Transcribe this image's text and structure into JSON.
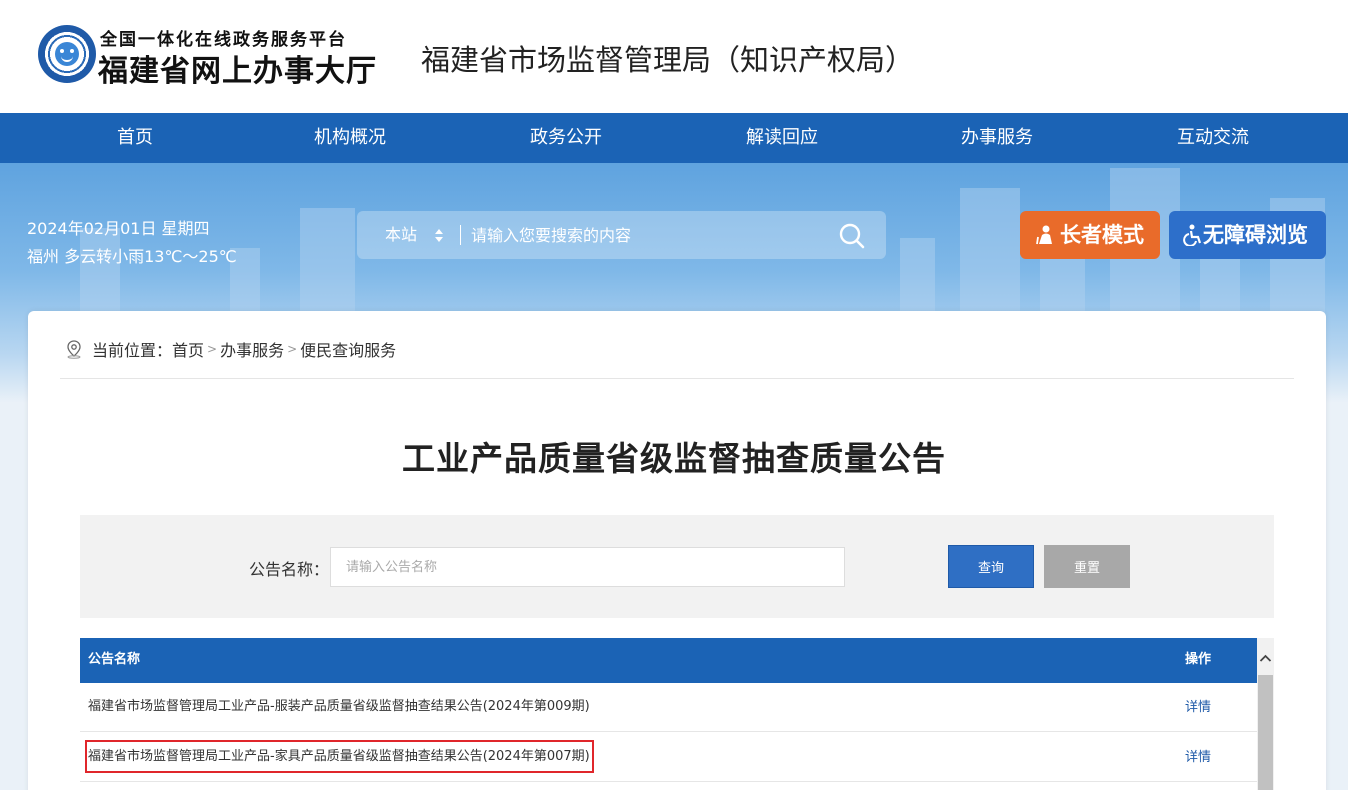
{
  "header": {
    "logo_top_text": "全国一体化在线政务服务平台",
    "logo_main_text": "福建省网上办事大厅",
    "site_title": "福建省市场监督管理局（知识产权局）"
  },
  "nav": {
    "items": [
      {
        "label": "首页"
      },
      {
        "label": "机构概况"
      },
      {
        "label": "政务公开"
      },
      {
        "label": "解读回应"
      },
      {
        "label": "办事服务"
      },
      {
        "label": "互动交流"
      }
    ]
  },
  "banner": {
    "date": "2024年02月01日 星期四",
    "weather": "福州 多云转小雨13℃～25℃",
    "search": {
      "scope_label": "本站",
      "placeholder": "请输入您要搜索的内容"
    },
    "elder_mode_label": "长者模式",
    "accessibility_label": "无障碍浏览"
  },
  "breadcrumb": {
    "prefix": "当前位置：",
    "items": [
      "首页",
      "办事服务",
      "便民查询服务"
    ],
    "separator": ">"
  },
  "page_title": "工业产品质量省级监督抽查质量公告",
  "filter": {
    "label": "公告名称：",
    "placeholder": "请输入公告名称",
    "query_label": "查询",
    "reset_label": "重置"
  },
  "table": {
    "headers": {
      "name": "公告名称",
      "operation": "操作"
    },
    "rows": [
      {
        "name": "福建省市场监督管理局工业产品-服装产品质量省级监督抽查结果公告(2024年第009期)",
        "operation": "详情"
      },
      {
        "name": "福建省市场监督管理局工业产品-家具产品质量省级监督抽查结果公告(2024年第007期)",
        "operation": "详情"
      }
    ]
  },
  "colors": {
    "primary": "#1b63b5",
    "elder_button": "#e96b2a",
    "accessibility_button": "#2d6fca",
    "highlight_border": "#e0262b"
  },
  "icons": {
    "logo": "smiley-emblem-icon",
    "search": "search-icon",
    "elder": "elder-person-icon",
    "accessibility": "wheelchair-icon",
    "location": "location-pin-icon"
  }
}
